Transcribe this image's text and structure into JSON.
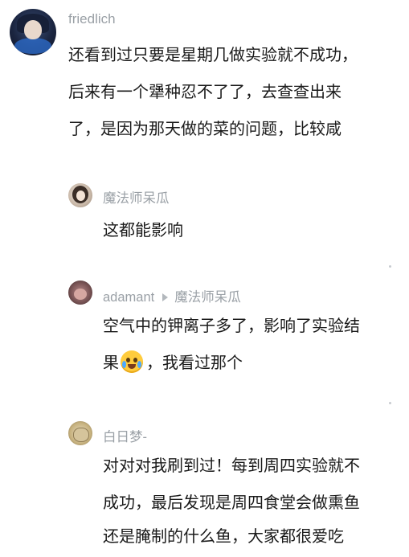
{
  "main_comment": {
    "author": "friedlich",
    "lines": [
      "还看到过只要是星期几做实验就不成功，",
      "后来有一个犟种忍不了了，去查查出来",
      "了，是因为那天做的菜的问题，比较咸"
    ]
  },
  "replies": [
    {
      "author": "魔法师呆瓜",
      "lines": [
        "这都能影响"
      ]
    },
    {
      "author": "adamant",
      "reply_to": "魔法师呆瓜",
      "line1": "空气中的钾离子多了，影响了实验结",
      "line2_pre": "果",
      "emoji": "crying-laughing-emoji",
      "line2_post": "，我看过那个"
    },
    {
      "author": "白日梦-",
      "lines": [
        "对对对我刷到过！每到周四实验就不",
        "成功，最后发现是周四食堂会做熏鱼",
        "还是腌制的什么鱼，大家都很爱吃"
      ]
    }
  ]
}
